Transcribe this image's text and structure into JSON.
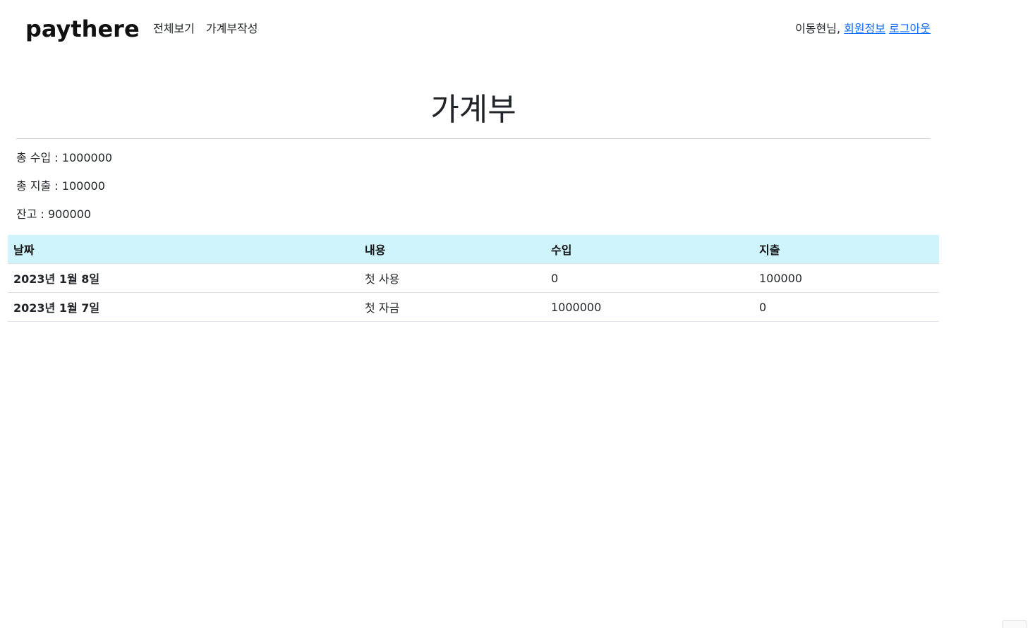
{
  "brand": "paythere",
  "nav": {
    "all": "전체보기",
    "write": "가계부작성"
  },
  "user": {
    "greeting": "이동현님,",
    "profile_link": "회원정보",
    "logout_link": "로그아웃"
  },
  "page_title": "가계부",
  "summary": {
    "income": "총 수입 : 1000000",
    "expense": "총 지출 : 100000",
    "balance": "잔고 : 900000"
  },
  "table": {
    "headers": [
      "날짜",
      "내용",
      "수입",
      "지출"
    ],
    "rows": [
      [
        "2023년 1월 8일",
        "첫 사용",
        "0",
        "100000"
      ],
      [
        "2023년 1월 7일",
        "첫 자금",
        "1000000",
        "0"
      ]
    ]
  },
  "colors": {
    "header_bg": "#cff4fc",
    "link": "#0d6efd"
  }
}
